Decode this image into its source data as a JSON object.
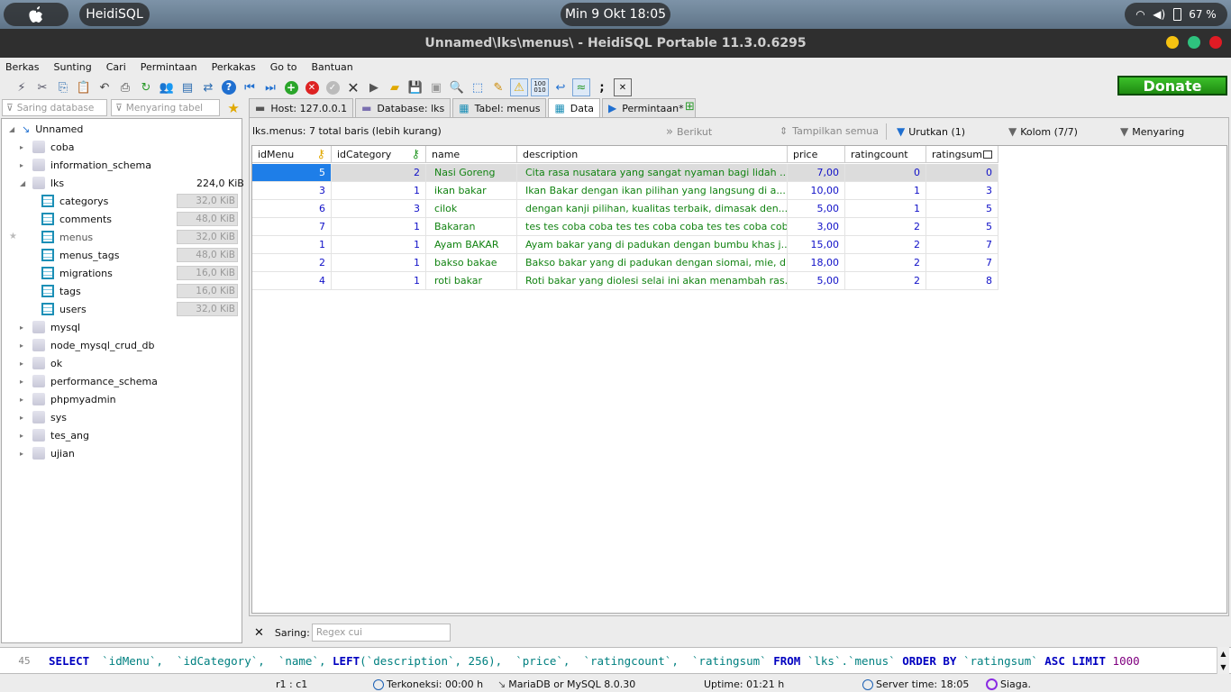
{
  "desktop": {
    "app_pill": "HeidiSQL",
    "clock": "Min  9 Okt  18:05",
    "battery": "67 %"
  },
  "window": {
    "title": "Unnamed\\lks\\menus\\ - HeidiSQL Portable 11.3.0.6295"
  },
  "menu": [
    "Berkas",
    "Sunting",
    "Cari",
    "Permintaan",
    "Perkakas",
    "Go to",
    "Bantuan"
  ],
  "donate_label": "Donate",
  "filters": {
    "database_placeholder": "Saring database",
    "table_placeholder": "Menyaring tabel"
  },
  "tree": {
    "root": "Unnamed",
    "databases_before": [
      "coba",
      "information_schema"
    ],
    "open_db": {
      "name": "lks",
      "size": "224,0 KiB"
    },
    "tables": [
      {
        "name": "categorys",
        "size": "32,0 KiB"
      },
      {
        "name": "comments",
        "size": "48,0 KiB"
      },
      {
        "name": "menus",
        "size": "32,0 KiB"
      },
      {
        "name": "menus_tags",
        "size": "48,0 KiB"
      },
      {
        "name": "migrations",
        "size": "16,0 KiB"
      },
      {
        "name": "tags",
        "size": "16,0 KiB"
      },
      {
        "name": "users",
        "size": "32,0 KiB"
      }
    ],
    "databases_after": [
      "mysql",
      "node_mysql_crud_db",
      "ok",
      "performance_schema",
      "phpmyadmin",
      "sys",
      "tes_ang",
      "ujian"
    ]
  },
  "tabs": [
    {
      "label": "Host: 127.0.0.1"
    },
    {
      "label": "Database: lks"
    },
    {
      "label": "Tabel: menus"
    },
    {
      "label": "Data"
    },
    {
      "label": "Permintaan*"
    }
  ],
  "data_view": {
    "info": "lks.menus: 7 total baris (lebih kurang)",
    "next_label": "Berikut",
    "show_all_label": "Tampilkan semua",
    "sort_label": "Urutkan (1)",
    "columns_label": "Kolom (7/7)",
    "filter_label": "Menyaring"
  },
  "grid": {
    "columns": [
      "idMenu",
      "idCategory",
      "name",
      "description",
      "price",
      "ratingcount",
      "ratingsum"
    ],
    "rows": [
      [
        "5",
        "2",
        "Nasi Goreng",
        "Cita rasa nusatara yang sangat nyaman bagi lidah ...",
        "7,00",
        "0",
        "0"
      ],
      [
        "3",
        "1",
        "ikan bakar",
        "Ikan Bakar dengan ikan pilihan yang langsung di a...",
        "10,00",
        "1",
        "3"
      ],
      [
        "6",
        "3",
        "cilok",
        "dengan kanji pilihan, kualitas terbaik, dimasak den...",
        "5,00",
        "1",
        "5"
      ],
      [
        "7",
        "1",
        "Bakaran",
        "tes tes coba coba tes tes coba coba tes tes coba cob...",
        "3,00",
        "2",
        "5"
      ],
      [
        "1",
        "1",
        "Ayam BAKAR",
        "Ayam bakar yang di padukan dengan bumbu khas j...",
        "15,00",
        "2",
        "7"
      ],
      [
        "2",
        "1",
        "bakso bakae",
        "Bakso bakar yang di padukan dengan siomai, mie, d...",
        "18,00",
        "2",
        "7"
      ],
      [
        "4",
        "1",
        "roti bakar",
        "Roti bakar yang diolesi selai ini akan menambah ras...",
        "5,00",
        "2",
        "8"
      ]
    ]
  },
  "search": {
    "label": "Saring:",
    "placeholder": "Regex cui"
  },
  "sql": {
    "line_no": "45",
    "select_kw": "SELECT",
    "cols_part1": "`idMenu`,  `idCategory`,  `name`, ",
    "left_kw": "LEFT",
    "left_args": "(`description`, 256),  `price`,  `ratingcount`,  `ratingsum` ",
    "from_kw": "FROM",
    "from_table": " `lks`.`menus` ",
    "order_kw": "ORDER BY",
    "order_col": " `ratingsum` ",
    "asc_kw": "ASC LIMIT",
    "limit": " 1000"
  },
  "status": {
    "cursor": "r1 : c1",
    "connected": "Terkoneksi: 00:00 h",
    "server_type": "MariaDB or MySQL 8.0.30",
    "uptime": "Uptime: 01:21 h",
    "server_time": "Server time: 18:05",
    "state": "Siaga."
  },
  "colors": {
    "number": "#1010c8",
    "text": "#128312",
    "selected_row": "#dcdcdc",
    "selected_cell": "#1e7ee8",
    "keyword": "#0000c0"
  }
}
